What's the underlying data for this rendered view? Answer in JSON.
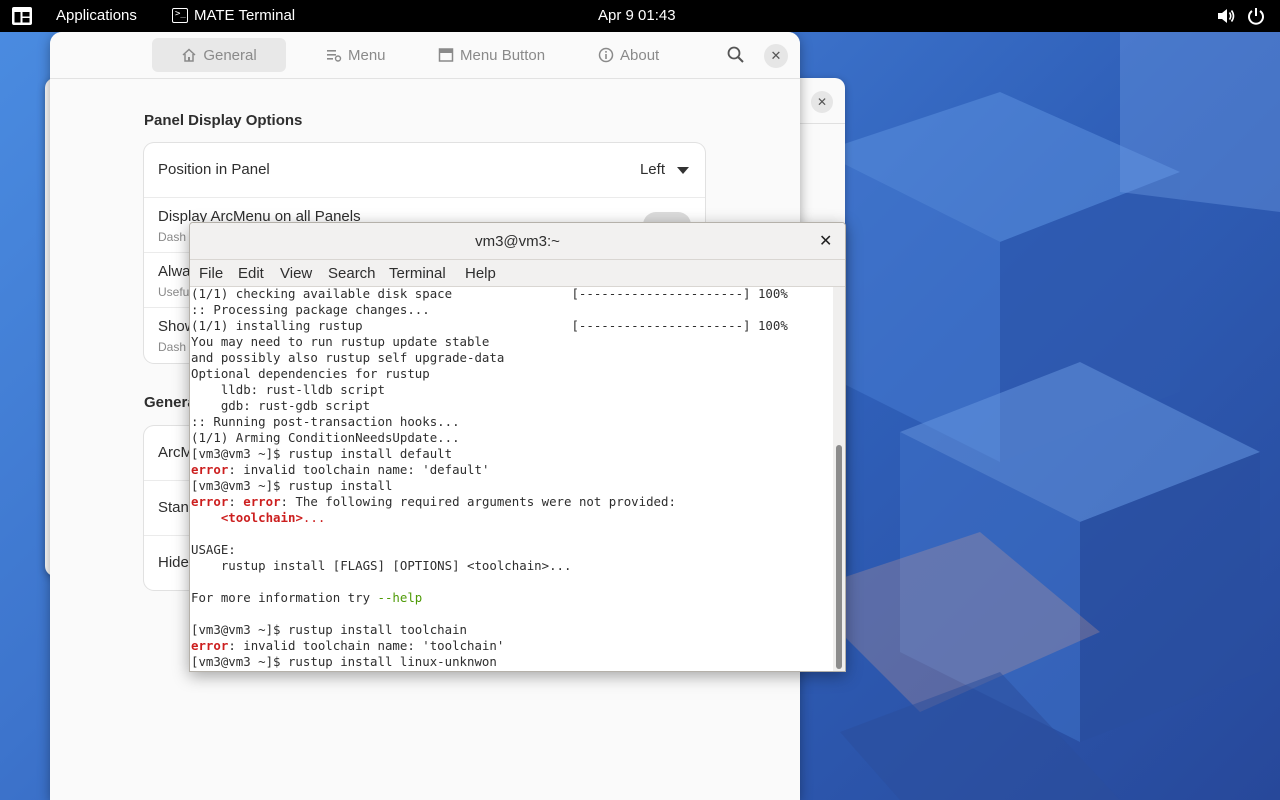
{
  "topbar": {
    "apps_label": "Applications",
    "active_app": "MATE Terminal",
    "clock": "Apr 9  01:43"
  },
  "settings": {
    "tabs": [
      {
        "label": "General",
        "icon": "home-icon",
        "active": true
      },
      {
        "label": "Menu",
        "icon": "menu-list-icon",
        "active": false
      },
      {
        "label": "Menu Button",
        "icon": "menu-button-icon",
        "active": false
      },
      {
        "label": "About",
        "icon": "info-icon",
        "active": false
      }
    ],
    "section1_title": "Panel Display Options",
    "rows1": [
      {
        "label": "Position in Panel",
        "value": "Left"
      },
      {
        "label": "Display ArcMenu on all Panels",
        "sub": "Dash"
      },
      {
        "label": "Alwa",
        "sub": "Usefu"
      },
      {
        "label": "Show",
        "sub": "Dash"
      }
    ],
    "section2_title": "Genera",
    "rows2": [
      {
        "label": "ArcM"
      },
      {
        "label": "Stand"
      },
      {
        "label": "Hide"
      }
    ]
  },
  "terminal": {
    "title": "vm3@vm3:~",
    "menu": [
      "File",
      "Edit",
      "View",
      "Search",
      "Terminal",
      "Help"
    ],
    "lines": [
      "(1/1) checking available disk space                [----------------------] 100%",
      ":: Processing package changes...",
      "(1/1) installing rustup                            [----------------------] 100%",
      "You may need to run rustup update stable",
      "and possibly also rustup self upgrade-data",
      "Optional dependencies for rustup",
      "    lldb: rust-lldb script",
      "    gdb: rust-gdb script",
      ":: Running post-transaction hooks...",
      "(1/1) Arming ConditionNeedsUpdate...",
      "[vm3@vm3 ~]$ rustup install default",
      "error: invalid toolchain name: 'default'",
      "[vm3@vm3 ~]$ rustup install",
      "error: error: The following required arguments were not provided:",
      "    <toolchain>...",
      "",
      "USAGE:",
      "    rustup install [FLAGS] [OPTIONS] <toolchain>...",
      "",
      "For more information try --help",
      "",
      "[vm3@vm3 ~]$ rustup install toolchain",
      "error: invalid toolchain name: 'toolchain'",
      "[vm3@vm3 ~]$ rustup install linux-unknwon"
    ]
  },
  "colors": {
    "error_red": "#cc1f1f",
    "help_green": "#4e9a06",
    "topbar_bg": "#000000",
    "wallpaper_blue": "#3d74cc"
  }
}
